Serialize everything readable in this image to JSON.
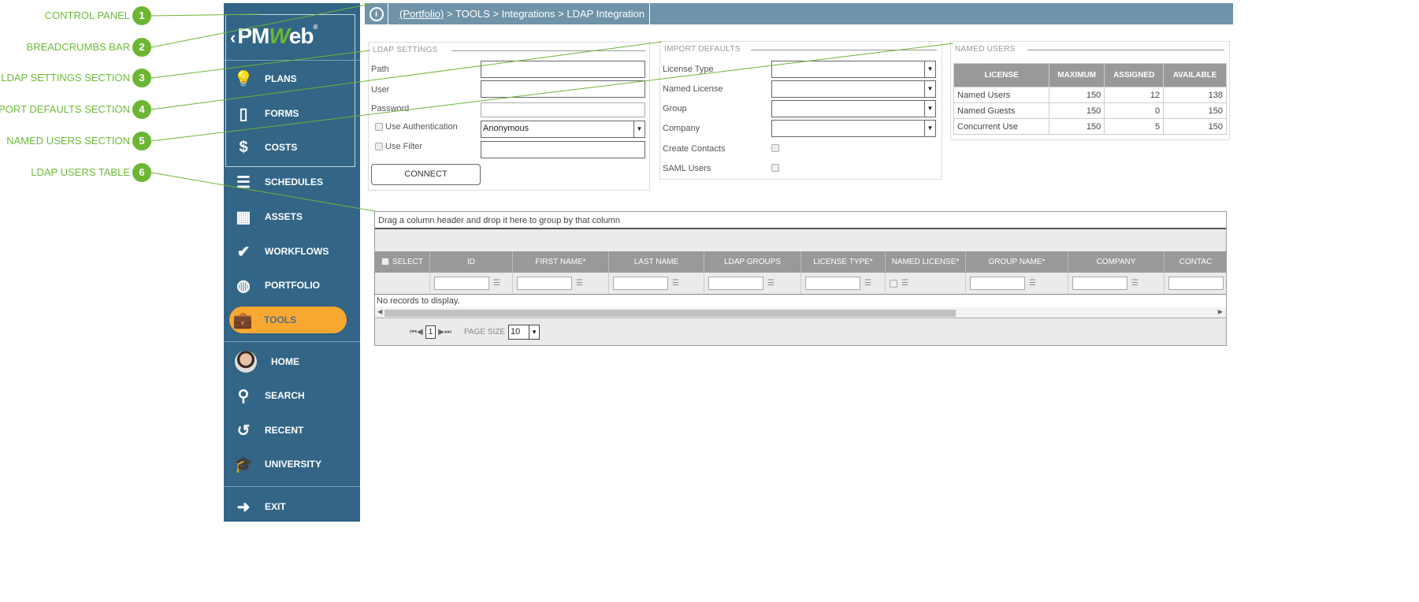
{
  "annotations": [
    {
      "num": "1",
      "label": "CONTROL PANEL"
    },
    {
      "num": "2",
      "label": "BREADCRUMBS BAR"
    },
    {
      "num": "3",
      "label": "LDAP SETTINGS SECTION"
    },
    {
      "num": "4",
      "label": "IMPORT DEFAULTS SECTION"
    },
    {
      "num": "5",
      "label": "NAMED USERS SECTION"
    },
    {
      "num": "6",
      "label": "LDAP USERS TABLE"
    }
  ],
  "sidebar": {
    "logo": "PMWeb",
    "back": "‹",
    "items": [
      {
        "label": "PLANS",
        "icon": "lightbulb-icon"
      },
      {
        "label": "FORMS",
        "icon": "document-icon"
      },
      {
        "label": "COSTS",
        "icon": "dollar-icon"
      },
      {
        "label": "SCHEDULES",
        "icon": "gantt-icon"
      },
      {
        "label": "ASSETS",
        "icon": "building-icon"
      },
      {
        "label": "WORKFLOWS",
        "icon": "checkmark-icon"
      },
      {
        "label": "PORTFOLIO",
        "icon": "globe-icon"
      },
      {
        "label": "TOOLS",
        "icon": "toolbox-icon"
      },
      {
        "label": "HOME",
        "icon": "avatar"
      },
      {
        "label": "SEARCH",
        "icon": "search-icon"
      },
      {
        "label": "RECENT",
        "icon": "history-icon"
      },
      {
        "label": "UNIVERSITY",
        "icon": "graduation-cap-icon"
      },
      {
        "label": "EXIT",
        "icon": "exit-icon"
      }
    ],
    "active_color": "#f8a831"
  },
  "breadcrumb": {
    "root": "(Portfolio)",
    "rest": " > TOOLS > Integrations > LDAP Integration"
  },
  "ldap": {
    "title": "LDAP SETTINGS",
    "path": "Path",
    "user": "User",
    "password": "Password",
    "use_auth": "Use Authentication",
    "auth_value": "Anonymous",
    "use_filter": "Use Filter",
    "connect": "CONNECT"
  },
  "import": {
    "title": "IMPORT DEFAULTS",
    "license_type": "License Type",
    "named_license": "Named License",
    "group": "Group",
    "company": "Company",
    "create_contacts": "Create Contacts",
    "saml": "SAML Users"
  },
  "named_users": {
    "title": "NAMED USERS",
    "headers": [
      "LICENSE",
      "MAXIMUM",
      "ASSIGNED",
      "AVAILABLE"
    ],
    "rows": [
      [
        "Named Users",
        "150",
        "12",
        "138"
      ],
      [
        "Named Guests",
        "150",
        "0",
        "150"
      ],
      [
        "Concurrent Use",
        "150",
        "5",
        "150"
      ]
    ]
  },
  "grid": {
    "group_hint": "Drag a column header and drop it here to group by that column",
    "columns": [
      "SELECT",
      "ID",
      "FIRST NAME*",
      "LAST NAME",
      "LDAP GROUPS",
      "LICENSE TYPE*",
      "NAMED LICENSE*",
      "GROUP NAME*",
      "COMPANY",
      "CONTAC"
    ],
    "empty": "No records to display.",
    "page": "1",
    "page_size_label": "PAGE SIZE",
    "page_size": "10"
  }
}
